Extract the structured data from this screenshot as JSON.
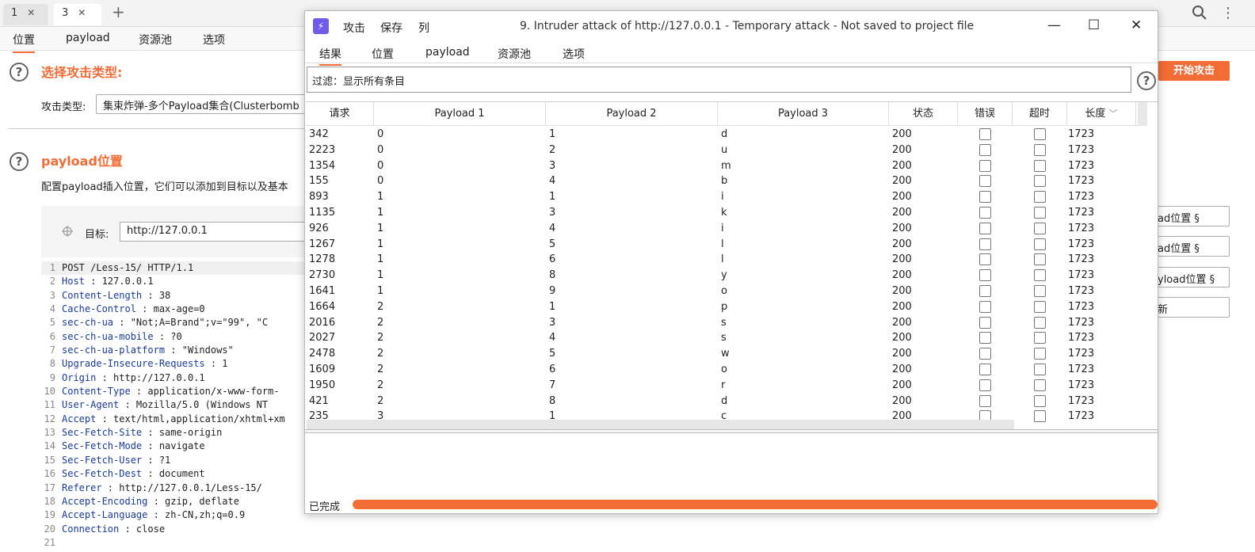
{
  "window_tabs": [
    {
      "label": "1"
    },
    {
      "label": "3"
    }
  ],
  "sub_tabs": [
    "位置",
    "payload",
    "资源池",
    "选项"
  ],
  "sections": {
    "attack_type": {
      "title": "选择攻击类型:",
      "label": "攻击类型:",
      "value": "集束炸弹-多个Payload集合(Clusterbomb"
    },
    "payload_pos": {
      "title": "payload位置",
      "desc": "配置payload插入位置，它们可以添加到目标以及基本",
      "target_label": "目标:",
      "target_value": "http://127.0.0.1"
    }
  },
  "request_lines": [
    {
      "n": "1",
      "k": "",
      "v": "POST  /Less-15/  HTTP/1.1"
    },
    {
      "n": "2",
      "k": "Host",
      "v": " :  127.0.0.1"
    },
    {
      "n": "3",
      "k": "Content-Length",
      "v": " :  38"
    },
    {
      "n": "4",
      "k": "Cache-Control",
      "v": " : max-age=0"
    },
    {
      "n": "5",
      "k": "sec-ch-ua",
      "v": " : \"Not;A=Brand\";v=\"99\",   \"C"
    },
    {
      "n": "6",
      "k": "sec-ch-ua-mobile",
      "v": " : ?0"
    },
    {
      "n": "7",
      "k": "sec-ch-ua-platform",
      "v": " : \"Windows\""
    },
    {
      "n": "8",
      "k": "Upgrade-Insecure-Requests",
      "v": "  :  1"
    },
    {
      "n": "9",
      "k": "Origin",
      "v": " : http://127.0.0.1"
    },
    {
      "n": "10",
      "k": "Content-Type",
      "v": " : application/x-www-form-"
    },
    {
      "n": "11",
      "k": "User-Agent",
      "v": " : Mozilla/5.0  (Windows  NT"
    },
    {
      "n": "12",
      "k": "Accept",
      "v": " : text/html,application/xhtml+xm"
    },
    {
      "n": "13",
      "k": "Sec-Fetch-Site",
      "v": " : same-origin"
    },
    {
      "n": "14",
      "k": "Sec-Fetch-Mode",
      "v": " : navigate"
    },
    {
      "n": "15",
      "k": "Sec-Fetch-User",
      "v": " : ?1"
    },
    {
      "n": "16",
      "k": "Sec-Fetch-Dest",
      "v": " : document"
    },
    {
      "n": "17",
      "k": "Referer",
      "v": " : http://127.0.0.1/Less-15/"
    },
    {
      "n": "18",
      "k": "Accept-Encoding",
      "v": " : gzip,  deflate"
    },
    {
      "n": "19",
      "k": "Accept-Language",
      "v": " : zh-CN,zh;q=0.9"
    },
    {
      "n": "20",
      "k": "Connection",
      "v": " : close"
    },
    {
      "n": "21",
      "k": "",
      "v": ""
    }
  ],
  "right_buttons": {
    "start": "开始攻击",
    "b1": "ad位置 §",
    "b2": "ad位置 §",
    "b3": "yload位置 §",
    "b4": "新"
  },
  "dialog": {
    "menu": [
      "攻击",
      "保存",
      "列"
    ],
    "title": "9. Intruder attack of http://127.0.0.1 - Temporary attack - Not saved to project file",
    "tabs": [
      "结果",
      "位置",
      "payload",
      "资源池",
      "选项"
    ],
    "filter": "过滤：显示所有条目",
    "columns": [
      "请求",
      "Payload 1",
      "Payload 2",
      "Payload 3",
      "状态",
      "错误",
      "超时",
      "长度"
    ],
    "rows": [
      [
        "342",
        "0",
        "1",
        "d",
        "200",
        "1723"
      ],
      [
        "2223",
        "0",
        "2",
        "u",
        "200",
        "1723"
      ],
      [
        "1354",
        "0",
        "3",
        "m",
        "200",
        "1723"
      ],
      [
        "155",
        "0",
        "4",
        "b",
        "200",
        "1723"
      ],
      [
        "893",
        "1",
        "1",
        "i",
        "200",
        "1723"
      ],
      [
        "1135",
        "1",
        "3",
        "k",
        "200",
        "1723"
      ],
      [
        "926",
        "1",
        "4",
        "i",
        "200",
        "1723"
      ],
      [
        "1267",
        "1",
        "5",
        "l",
        "200",
        "1723"
      ],
      [
        "1278",
        "1",
        "6",
        "l",
        "200",
        "1723"
      ],
      [
        "2730",
        "1",
        "8",
        "y",
        "200",
        "1723"
      ],
      [
        "1641",
        "1",
        "9",
        "o",
        "200",
        "1723"
      ],
      [
        "1664",
        "2",
        "1",
        "p",
        "200",
        "1723"
      ],
      [
        "2016",
        "2",
        "3",
        "s",
        "200",
        "1723"
      ],
      [
        "2027",
        "2",
        "4",
        "s",
        "200",
        "1723"
      ],
      [
        "2478",
        "2",
        "5",
        "w",
        "200",
        "1723"
      ],
      [
        "1609",
        "2",
        "6",
        "o",
        "200",
        "1723"
      ],
      [
        "1950",
        "2",
        "7",
        "r",
        "200",
        "1723"
      ],
      [
        "421",
        "2",
        "8",
        "d",
        "200",
        "1723"
      ],
      [
        "235",
        "3",
        "1",
        "c",
        "200",
        "1723"
      ]
    ],
    "status": "已完成",
    "progress": 100
  },
  "colors": {
    "accent": "#f36c35",
    "logo": "#6f5be8"
  }
}
